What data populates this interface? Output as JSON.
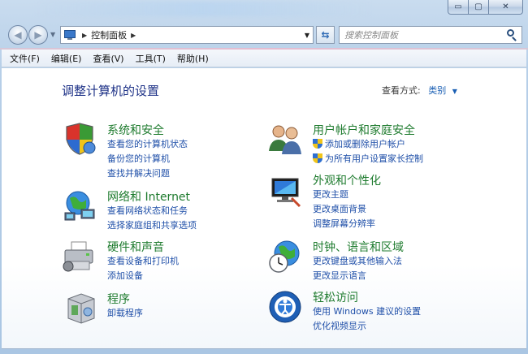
{
  "window": {
    "caption_buttons": {
      "minimize": "▭",
      "maximize": "▢",
      "close": "✕"
    }
  },
  "nav": {
    "breadcrumb": [
      "控制面板"
    ],
    "search_placeholder": "搜索控制面板"
  },
  "menu": {
    "items": [
      "文件(F)",
      "编辑(E)",
      "查看(V)",
      "工具(T)",
      "帮助(H)"
    ]
  },
  "content": {
    "title": "调整计算机的设置",
    "view_by_label": "查看方式:",
    "view_by_value": "类别",
    "categories": [
      {
        "title": "系统和安全",
        "icon": "security-shield-icon",
        "links": [
          "查看您的计算机状态",
          "备份您的计算机",
          "查找并解决问题"
        ]
      },
      {
        "title": "网络和 Internet",
        "icon": "network-globe-icon",
        "links": [
          "查看网络状态和任务",
          "选择家庭组和共享选项"
        ]
      },
      {
        "title": "硬件和声音",
        "icon": "printer-hardware-icon",
        "links": [
          "查看设备和打印机",
          "添加设备"
        ]
      },
      {
        "title": "程序",
        "icon": "programs-box-icon",
        "links": [
          "卸载程序"
        ]
      },
      {
        "title": "用户帐户和家庭安全",
        "icon": "users-icon",
        "links": [
          "添加或删除用户帐户",
          "为所有用户设置家长控制"
        ]
      },
      {
        "title": "外观和个性化",
        "icon": "appearance-monitor-icon",
        "links": [
          "更改主题",
          "更改桌面背景",
          "调整屏幕分辨率"
        ]
      },
      {
        "title": "时钟、语言和区域",
        "icon": "clock-globe-icon",
        "links": [
          "更改键盘或其他输入法",
          "更改显示语言"
        ]
      },
      {
        "title": "轻松访问",
        "icon": "ease-of-access-icon",
        "links": [
          "使用 Windows 建议的设置",
          "优化视频显示"
        ]
      }
    ]
  },
  "colors": {
    "category_title": "#1e7b2e",
    "link": "#1f4fa8",
    "page_title": "#1e3287"
  }
}
